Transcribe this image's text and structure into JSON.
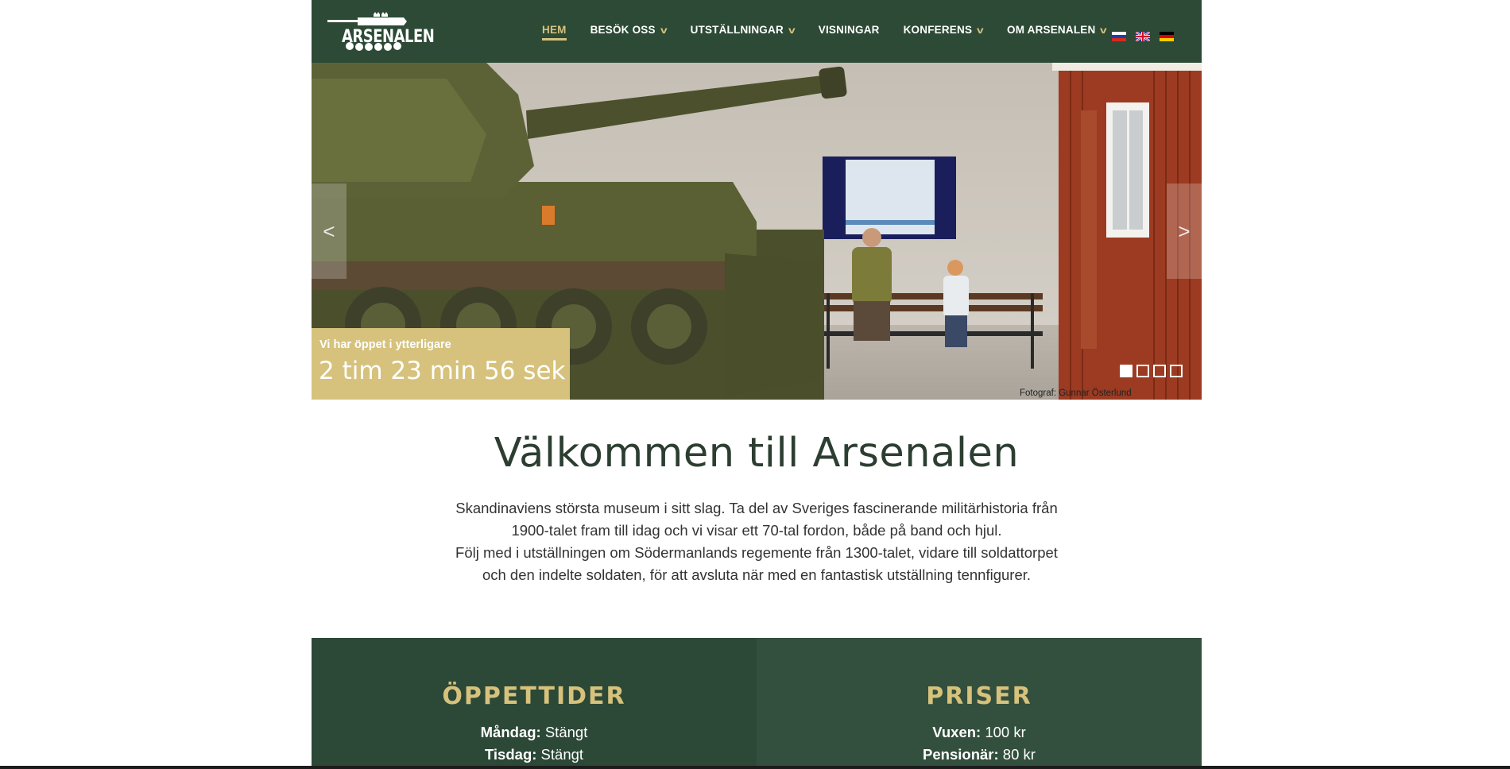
{
  "header": {
    "logo_text": "ARSENALEN",
    "nav": [
      {
        "label": "HEM",
        "active": true,
        "dropdown": false
      },
      {
        "label": "BESÖK OSS",
        "active": false,
        "dropdown": true
      },
      {
        "label": "UTSTÄLLNINGAR",
        "active": false,
        "dropdown": true
      },
      {
        "label": "VISNINGAR",
        "active": false,
        "dropdown": false
      },
      {
        "label": "KONFERENS",
        "active": false,
        "dropdown": true
      },
      {
        "label": "OM ARSENALEN",
        "active": false,
        "dropdown": true
      }
    ],
    "chevron_glyph": "v",
    "languages": [
      "ru-flag-icon",
      "gb-flag-icon",
      "de-flag-icon"
    ]
  },
  "hero": {
    "prev_glyph": "<",
    "next_glyph": ">",
    "countdown_label": "Vi har öppet i ytterligare",
    "countdown_value": "2 tim 23 min 56 sek",
    "slide_count": 4,
    "active_slide": 1,
    "photo_credit": "Fotograf: Gunnar Österlund"
  },
  "welcome": {
    "title": "Välkommen till Arsenalen",
    "paragraph_1": "Skandinaviens största museum i sitt slag. Ta del av Sveriges fascinerande militärhistoria från 1900-talet fram till idag och vi visar ett 70-tal fordon, både på band och hjul.",
    "paragraph_2": "Följ med i utställningen om Södermanlands regemente från 1300-talet, vidare till soldattorpet och den indelte soldaten, för att avsluta när med en fantastisk utställning tennfigurer."
  },
  "opening_hours": {
    "title": "ÖPPETTIDER",
    "rows": [
      {
        "day": "Måndag:",
        "value": "Stängt"
      },
      {
        "day": "Tisdag:",
        "value": "Stängt"
      }
    ]
  },
  "prices": {
    "title": "PRISER",
    "rows": [
      {
        "label": "Vuxen:",
        "value": "100 kr"
      },
      {
        "label": "Pensionär:",
        "value": "80 kr"
      }
    ]
  },
  "colors": {
    "header_green": "#2c4a35",
    "gold": "#d6c27c",
    "title_green": "#2c3e31"
  }
}
